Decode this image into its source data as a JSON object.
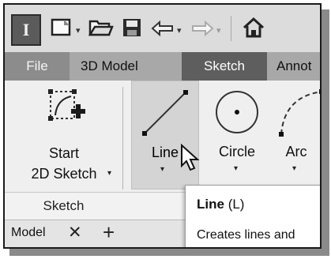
{
  "quick_access": {
    "app_button": "I",
    "icons": [
      "new-icon",
      "open-icon",
      "save-icon",
      "undo-icon",
      "redo-icon",
      "home-icon"
    ]
  },
  "tabs": [
    {
      "label": "File",
      "active": false
    },
    {
      "label": "3D Model",
      "active": false
    },
    {
      "label": "Sketch",
      "active": true
    },
    {
      "label": "Annot",
      "active": false
    }
  ],
  "ribbon": {
    "start_sketch": {
      "line1": "Start",
      "line2": "2D Sketch"
    },
    "line": {
      "label": "Line"
    },
    "circle": {
      "label": "Circle"
    },
    "arc": {
      "label": "Arc"
    },
    "group_label": "Sketch"
  },
  "doc_tabs": {
    "model_label": "Model",
    "close_glyph": "✕",
    "add_glyph": "+"
  },
  "tooltip": {
    "title": "Line",
    "shortcut": "(L)",
    "description": "Creates lines and"
  },
  "colors": {
    "active_tab": "#5e5e5e",
    "file_tab": "#8c8c8c",
    "tab_strip": "#a8a8a8"
  }
}
